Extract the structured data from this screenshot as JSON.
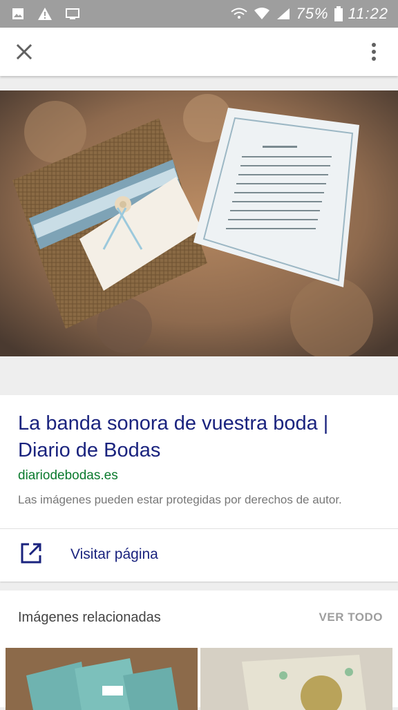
{
  "status_bar": {
    "battery_percent": "75%",
    "time": "11:22"
  },
  "toolbar": {
    "close_icon": "close-icon",
    "more_icon": "more-vert-icon"
  },
  "result": {
    "title": "La banda sonora de vuestra boda | Diario de Bodas",
    "domain": "diariodebodas.es",
    "notice": "Las imágenes pueden estar protegidas por derechos de autor.",
    "visit_label": "Visitar página"
  },
  "related": {
    "title": "Imágenes relacionadas",
    "see_all": "VER TODO"
  },
  "colors": {
    "status_bar": "#9e9e9e",
    "link_blue": "#1a237e",
    "domain_green": "#0b7a2e"
  }
}
